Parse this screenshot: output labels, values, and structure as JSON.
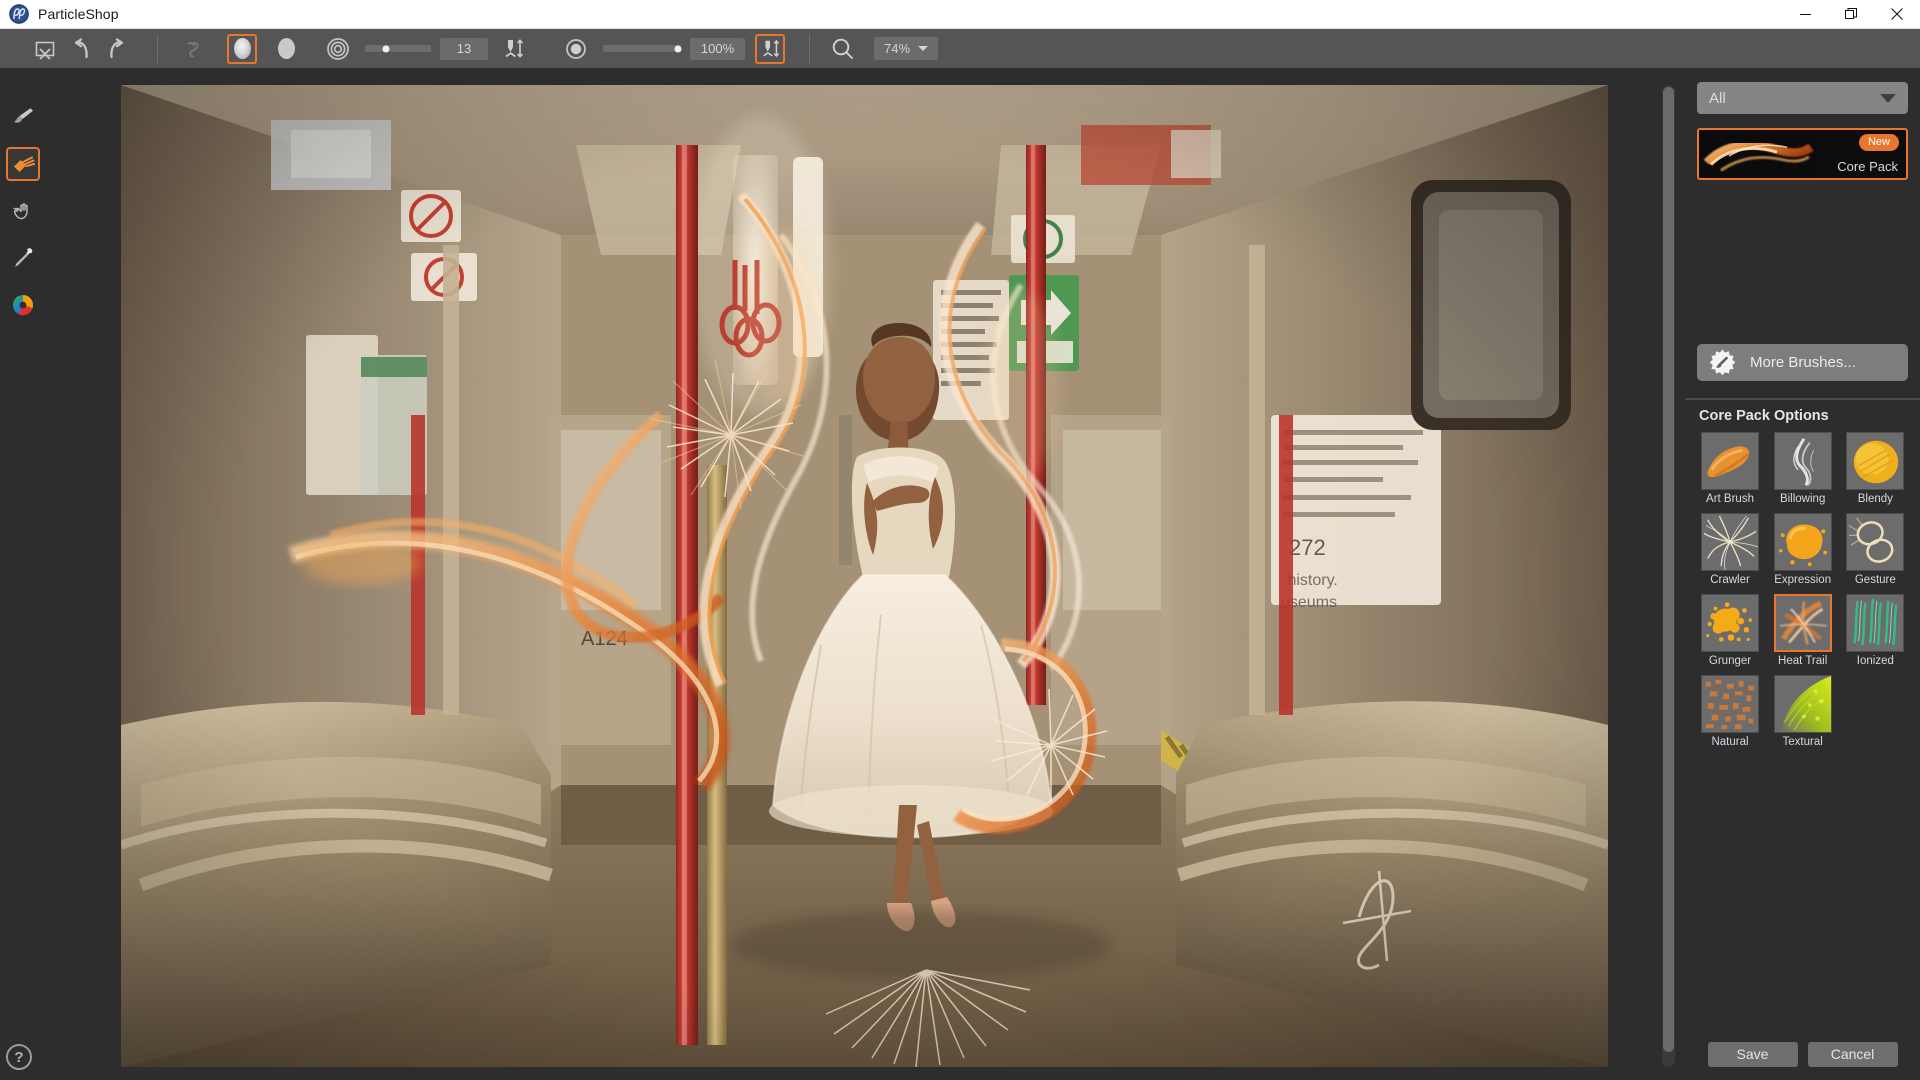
{
  "window": {
    "app_title": "ParticleShop",
    "logo_icon": "particleshop-logo-icon",
    "minimize_icon": "minimize-icon",
    "restore_icon": "restore-icon",
    "close_icon": "close-icon"
  },
  "toolbar": {
    "clear_icon": "clear-canvas-icon",
    "undo_icon": "undo-arrow-icon",
    "redo_icon": "redo-arrow-icon",
    "link_icon": "chain-link-icon",
    "soft_brush_icon": "soft-round-brush-icon",
    "hard_brush_icon": "hard-round-brush-icon",
    "size_icon": "brush-size-rings-icon",
    "size_value": "13",
    "size_pressure_icon": "size-pressure-icon",
    "opacity_icon": "opacity-dot-icon",
    "opacity_value": "100%",
    "opacity_pressure_icon": "opacity-pressure-icon",
    "magnifier_icon": "magnifier-icon",
    "zoom_value": "74%"
  },
  "tools": [
    {
      "name": "paint-brush-tool",
      "icon": "paint-brush-icon",
      "selected": false
    },
    {
      "name": "particle-brush-tool",
      "icon": "particle-brush-icon",
      "selected": true
    },
    {
      "name": "smudge-tool",
      "icon": "smudge-hand-icon",
      "selected": false
    },
    {
      "name": "eyedropper-tool",
      "icon": "eyedropper-icon",
      "selected": false
    },
    {
      "name": "color-wheel-tool",
      "icon": "color-wheel-icon",
      "selected": false
    }
  ],
  "help": {
    "label": "?",
    "icon": "help-question-icon"
  },
  "canvas": {
    "artwork_description": "subway-car-ballerina-with-fire-particles",
    "scrollbar_icon": "vertical-scrollbar"
  },
  "right_panel": {
    "filter_label": "All",
    "filter_caret_icon": "chevron-down-icon",
    "pack": {
      "name": "Core Pack",
      "badge": "New",
      "thumb_icon": "flame-swoosh-thumb"
    },
    "more_brushes": {
      "label": "More Brushes...",
      "icon": "brush-burst-icon"
    },
    "options_title": "Core Pack Options",
    "options": [
      {
        "label": "Art Brush",
        "selected": false,
        "thumb": "art-brush-thumb"
      },
      {
        "label": "Billowing",
        "selected": false,
        "thumb": "billowing-thumb"
      },
      {
        "label": "Blendy",
        "selected": false,
        "thumb": "blendy-thumb"
      },
      {
        "label": "Crawler",
        "selected": false,
        "thumb": "crawler-thumb"
      },
      {
        "label": "Expression",
        "selected": false,
        "thumb": "expression-thumb"
      },
      {
        "label": "Gesture",
        "selected": false,
        "thumb": "gesture-thumb"
      },
      {
        "label": "Grunger",
        "selected": false,
        "thumb": "grunger-thumb"
      },
      {
        "label": "Heat Trail",
        "selected": true,
        "thumb": "heat-trail-thumb"
      },
      {
        "label": "Ionized",
        "selected": false,
        "thumb": "ionized-thumb"
      },
      {
        "label": "Natural",
        "selected": false,
        "thumb": "natural-thumb"
      },
      {
        "label": "Textural",
        "selected": false,
        "thumb": "textural-thumb"
      }
    ],
    "save_label": "Save",
    "cancel_label": "Cancel"
  },
  "colors": {
    "accent": "#e8762c",
    "toolbar_bg": "#555555",
    "panel_bg": "#2d2d2d",
    "field_bg": "#6b6b6b",
    "text": "#d3dae3"
  }
}
